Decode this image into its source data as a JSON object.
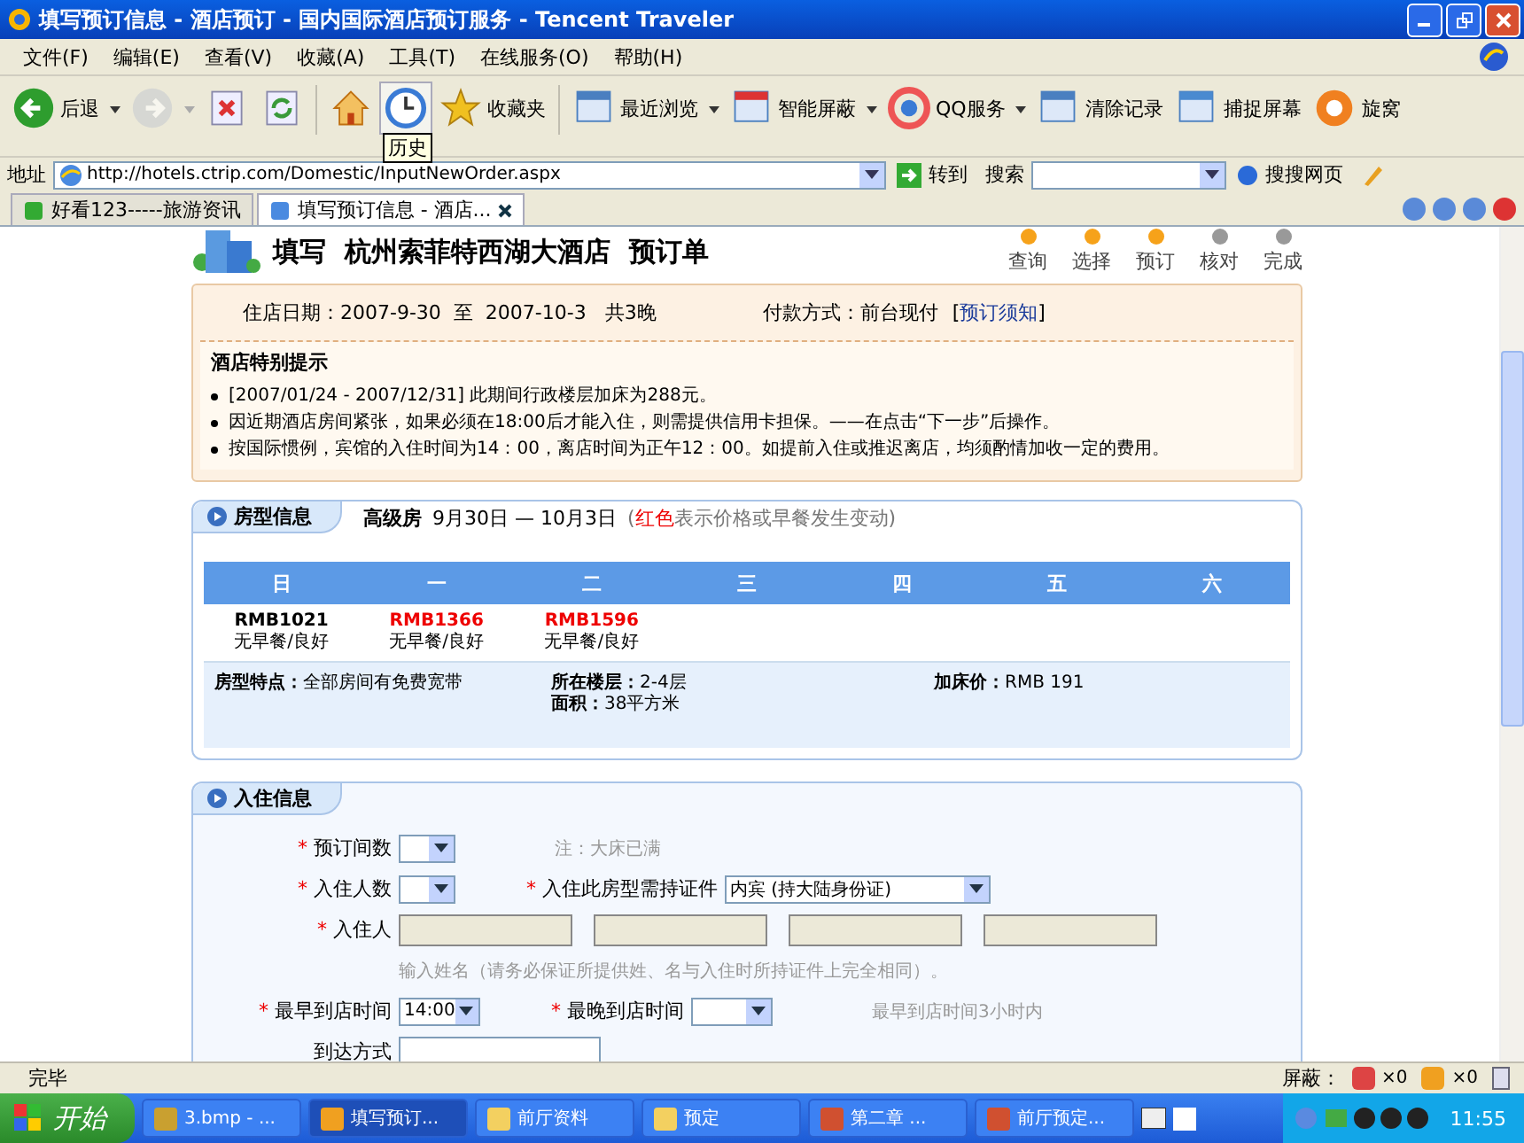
{
  "window": {
    "title": "填写预订信息 - 酒店预订 - 国内国际酒店预订服务 - Tencent Traveler"
  },
  "menu": [
    "文件(F)",
    "编辑(E)",
    "查看(V)",
    "收藏(A)",
    "工具(T)",
    "在线服务(O)",
    "帮助(H)"
  ],
  "toolbar": [
    {
      "kind": "back",
      "label": "后退",
      "dropdown": true,
      "disabled": false
    },
    {
      "kind": "forward",
      "dropdown": true,
      "disabled": true
    },
    {
      "kind": "stop",
      "disabled": false
    },
    {
      "kind": "refresh",
      "disabled": false
    },
    {
      "kind": "home",
      "disabled": false
    },
    {
      "kind": "history",
      "disabled": false,
      "tooltip": "历史"
    },
    {
      "kind": "favorites",
      "label": "收藏夹",
      "disabled": false
    },
    {
      "kind": "recent",
      "label": "最近浏览",
      "dropdown": true,
      "disabled": false
    },
    {
      "kind": "block",
      "label": "智能屏蔽",
      "dropdown": true,
      "disabled": false
    },
    {
      "kind": "qq",
      "label": "QQ服务",
      "dropdown": true,
      "disabled": false
    },
    {
      "kind": "clear",
      "label": "清除记录",
      "disabled": false
    },
    {
      "kind": "capture",
      "label": "捕捉屏幕",
      "disabled": false
    },
    {
      "kind": "whirl",
      "label": "旋窝",
      "disabled": false
    }
  ],
  "address_bar": {
    "label": "地址",
    "url": "http://hotels.ctrip.com/Domestic/InputNewOrder.aspx",
    "go": "转到",
    "search_label": "搜索",
    "search_engine": "搜搜网页"
  },
  "tabs": [
    {
      "title": "好看123-----旅游资讯",
      "selected": false
    },
    {
      "title": "填写预订信息 - 酒店...",
      "selected": true
    }
  ],
  "page": {
    "title": "填写  杭州索菲特西湖大酒店  预订单",
    "steps": [
      {
        "label": "查询",
        "done": true
      },
      {
        "label": "选择",
        "done": true
      },
      {
        "label": "预订",
        "done": true
      },
      {
        "label": "核对",
        "done": false
      },
      {
        "label": "完成",
        "done": false
      }
    ],
    "stay": "住店日期：2007-9-30  至  2007-10-3   共3晚",
    "payment": "付款方式：前台现付",
    "bracket_open": "[",
    "notice_link": "预订须知",
    "bracket_close": "]",
    "notices_title": "酒店特别提示",
    "notices": [
      "[2007/01/24 - 2007/12/31] 此期间行政楼层加床为288元。",
      "因近期酒店房间紧张，如果必须在18:00后才能入住，则需提供信用卡担保。——在点击“下一步”后操作。",
      "按国际惯例，宾馆的入住时间为14：00，离店时间为正午12：00。如提前入住或推迟离店，均须酌情加收一定的费用。"
    ]
  },
  "room_info": {
    "tab": "房型信息",
    "room": "高级房",
    "dates": "9月30日 — 10月3日",
    "legend_open": "(",
    "legend_red": "红色",
    "legend_rest": "表示价格或早餐发生变动)",
    "weekdays": [
      "日",
      "一",
      "二",
      "三",
      "四",
      "五",
      "六"
    ],
    "prices": [
      {
        "price": "RMB1021",
        "changed": false,
        "meal": "无早餐/良好"
      },
      {
        "price": "RMB1366",
        "changed": true,
        "meal": "无早餐/良好"
      },
      {
        "price": "RMB1596",
        "changed": true,
        "meal": "无早餐/良好"
      }
    ],
    "features": [
      {
        "label": "房型特点：",
        "value": "全部房间有免费宽带"
      },
      {
        "label": "所在楼层：",
        "value": "2-4层"
      },
      {
        "label": "面积：",
        "value": "38平方米"
      },
      {
        "label": "加床价：",
        "value": "RMB 191"
      }
    ]
  },
  "guest_info": {
    "tab": "入住信息",
    "required_mark": "*",
    "rows": [
      {
        "fields": [
          {
            "kind": "select",
            "label": "预订间数",
            "required": true
          },
          {
            "kind": "note",
            "text": "注：大床已满"
          }
        ]
      },
      {
        "fields": [
          {
            "kind": "select",
            "label": "入住人数",
            "required": true
          },
          {
            "kind": "wide-select",
            "label": "入住此房型需持证件",
            "required": true,
            "value": "内宾 (持大陆身份证)"
          }
        ]
      },
      {
        "fields": [
          {
            "kind": "names",
            "label": "入住人",
            "required": true,
            "inputs": [
              {
                "disabled": true
              },
              {
                "disabled": true
              },
              {
                "disabled": true
              },
              {
                "disabled": true
              }
            ]
          }
        ]
      },
      {
        "fields": [
          {
            "kind": "hint",
            "text": "输入姓名（请务必保证所提供姓、名与入住时所持证件上完全相同）。"
          }
        ]
      },
      {
        "fields": [
          {
            "kind": "select",
            "label": "最早到店时间",
            "required": true,
            "value": "14:00"
          },
          {
            "kind": "select",
            "label": "最晚到店时间",
            "required": true
          },
          {
            "kind": "note",
            "text": "最早到店时间3小时内"
          }
        ]
      },
      {
        "fields": [
          {
            "kind": "text",
            "label": "到达方式",
            "required": false
          }
        ]
      }
    ]
  },
  "status_bar": {
    "text": "完毕",
    "block_label": "屏蔽：",
    "counts": [
      "×0",
      "×0"
    ]
  },
  "taskbar": {
    "start": "开始",
    "items": [
      {
        "title": "3.bmp - ...",
        "kind": "paint",
        "selected": false
      },
      {
        "title": "填写预订...",
        "kind": "browser",
        "selected": true
      },
      {
        "title": "前厅资料",
        "kind": "folder",
        "selected": false
      },
      {
        "title": "预定",
        "kind": "folder",
        "selected": false
      },
      {
        "title": "第二章 ...",
        "kind": "doc",
        "selected": false
      },
      {
        "title": "前厅预定...",
        "kind": "doc",
        "selected": false
      }
    ],
    "clock": "11:55"
  }
}
